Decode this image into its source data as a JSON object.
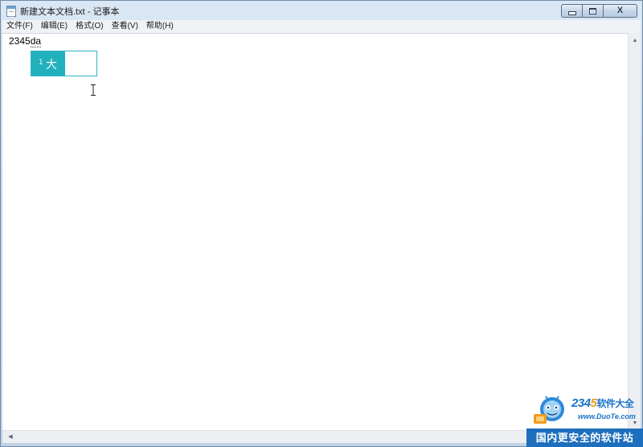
{
  "window": {
    "title": "新建文本文档.txt - 记事本"
  },
  "caption_buttons": {
    "minimize": "minimize",
    "maximize": "maximize",
    "close": "X"
  },
  "menu": {
    "items": [
      {
        "label": "文件(F)"
      },
      {
        "label": "编辑(E)"
      },
      {
        "label": "格式(O)"
      },
      {
        "label": "查看(V)"
      },
      {
        "label": "帮助(H)"
      }
    ]
  },
  "editor": {
    "committed_text": "2345",
    "composing_text": "da"
  },
  "ime": {
    "candidate_index": "1",
    "candidate_text": "大"
  },
  "watermark": {
    "brand_digits": [
      "2",
      "3",
      "4",
      "5"
    ],
    "brand_suffix": "软件大全",
    "url": "www.DuoTe.com",
    "slogan": "国内更安全的软件站"
  },
  "colors": {
    "ime_highlight": "#22b0bd",
    "brand_blue": "#1a74c8",
    "brand_orange": "#f29a1d"
  }
}
